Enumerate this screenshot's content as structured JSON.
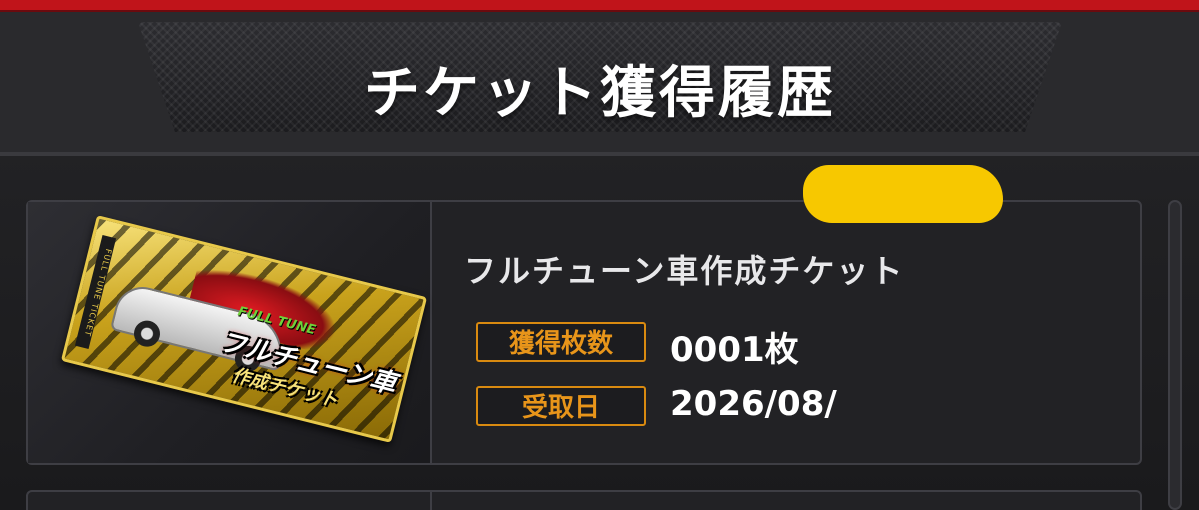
{
  "header": {
    "title": "チケット獲得履歴"
  },
  "history": {
    "items": [
      {
        "name": "フルチューン車作成チケット",
        "ticket_art": {
          "side_text": "FULL TUNE TICKET",
          "logo_top": "FULL TUNE",
          "logo_main": "フルチューン車",
          "logo_sub": "作成チケット"
        },
        "count_label": "獲得枚数",
        "count_value": "0001枚",
        "date_label": "受取日",
        "date_value": "2026/08/"
      }
    ]
  },
  "colors": {
    "accent_red": "#c0141a",
    "badge_orange": "#d98a10",
    "redaction_yellow": "#f7c800"
  },
  "icons": {
    "scrollbar": "scrollbar-track"
  }
}
